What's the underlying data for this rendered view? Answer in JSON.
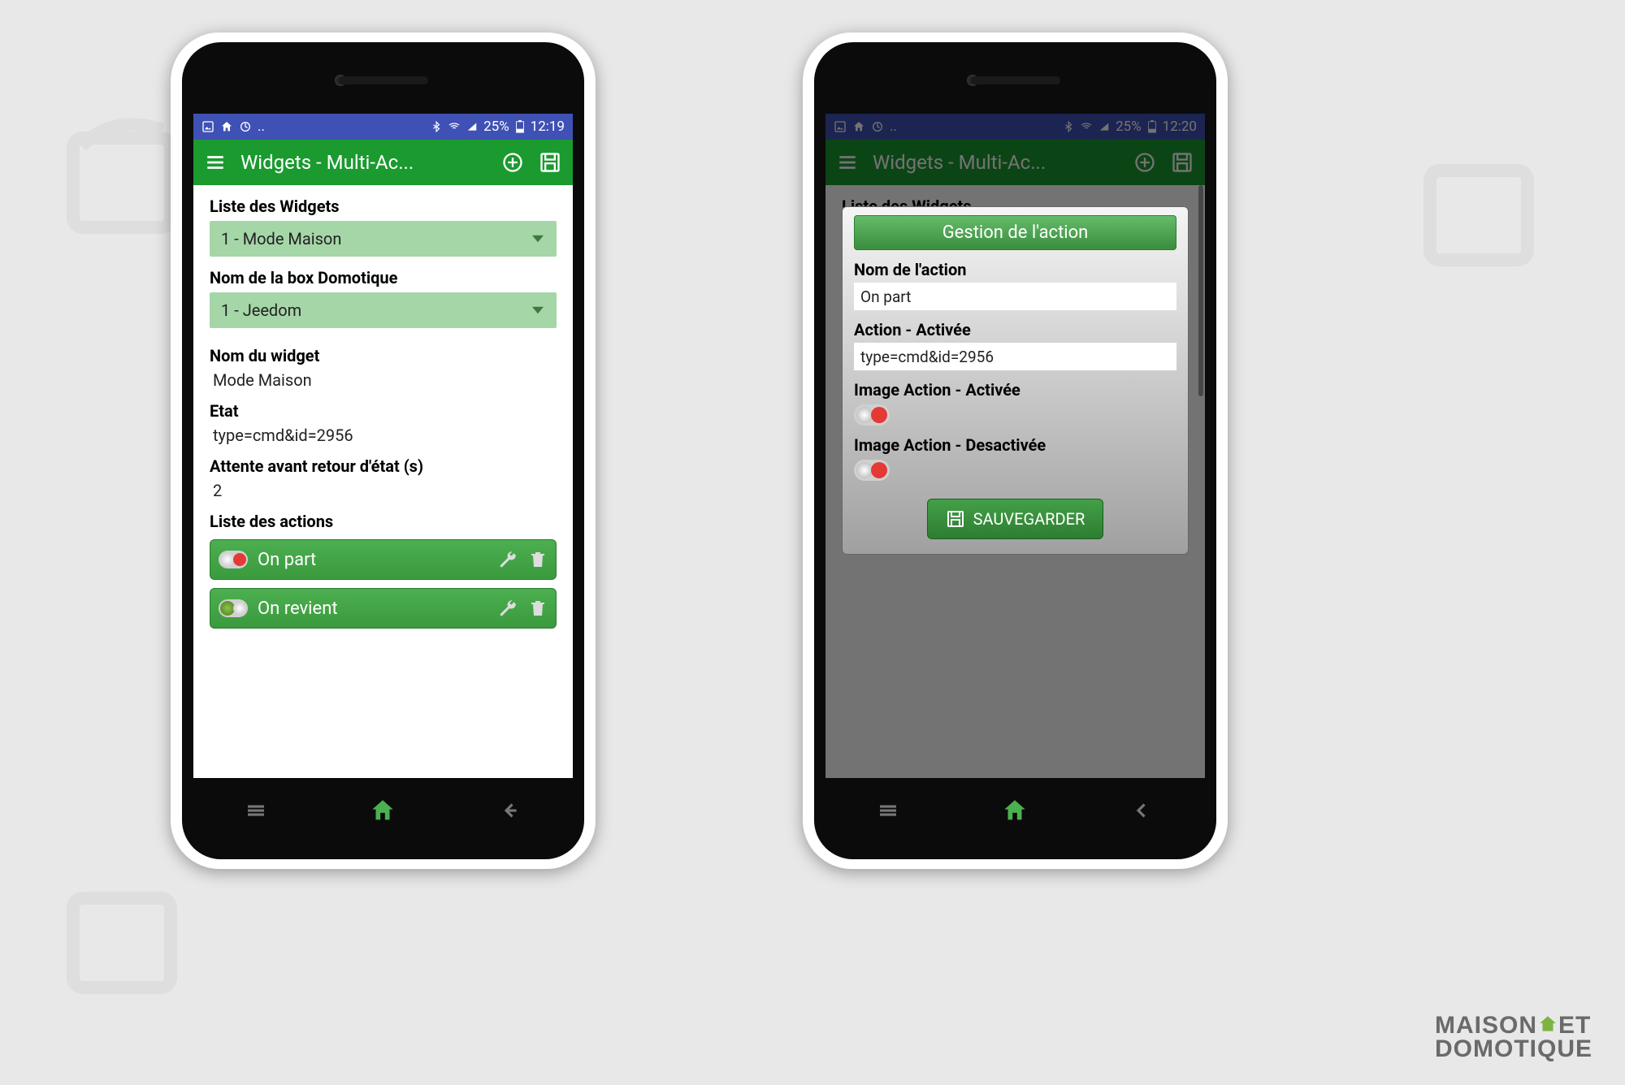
{
  "status": {
    "battery": "25%",
    "time_left": "12:19",
    "time_right": "12:20"
  },
  "appbar": {
    "title": "Widgets - Multi-Ac..."
  },
  "left": {
    "sections": {
      "widgets_list_label": "Liste des Widgets",
      "widgets_list_value": "1 - Mode Maison",
      "box_label": "Nom de la box Domotique",
      "box_value": "1 - Jeedom",
      "widget_name_label": "Nom du widget",
      "widget_name_value": "Mode Maison",
      "state_label": "Etat",
      "state_value": "type=cmd&id=2956",
      "wait_label": "Attente avant retour d'état (s)",
      "wait_value": "2",
      "actions_label": "Liste des actions",
      "actions": [
        {
          "name": "On part",
          "kind": "red"
        },
        {
          "name": "On revient",
          "kind": "green"
        }
      ]
    }
  },
  "dialog": {
    "title": "Gestion de l'action",
    "name_label": "Nom de l'action",
    "name_value": "On part",
    "action_on_label": "Action - Activée",
    "action_on_value": "type=cmd&id=2956",
    "img_on_label": "Image Action - Activée",
    "img_off_label": "Image Action - Desactivée",
    "save": "SAUVEGARDER"
  },
  "brand": {
    "l1a": "maison",
    "l1b": "et",
    "l2": "domotique"
  }
}
